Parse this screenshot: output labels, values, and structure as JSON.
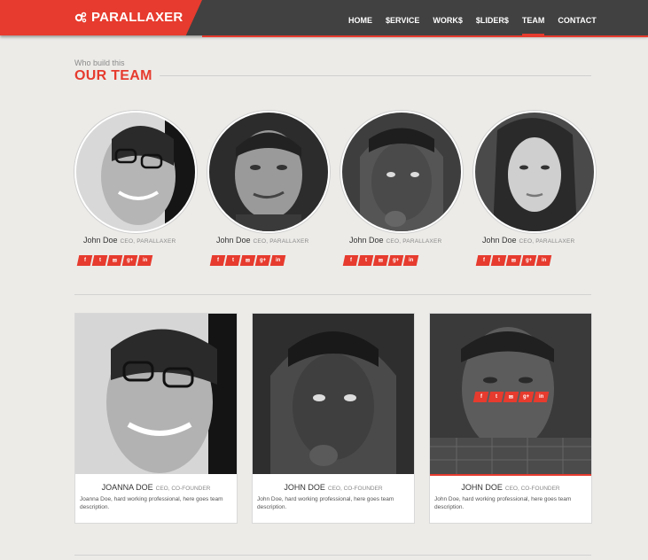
{
  "brand": {
    "name": "PARALLAXER",
    "accent": "#e63b2e",
    "header_bg": "#414141"
  },
  "nav": {
    "items": [
      {
        "label": "HOME"
      },
      {
        "label": "$ERVICE"
      },
      {
        "label": "WORK$"
      },
      {
        "label": "$LIDER$"
      },
      {
        "label": "TEAM",
        "active": true
      },
      {
        "label": "CONTACT"
      }
    ]
  },
  "section": {
    "subtitle": "Who build this",
    "title": "OUR TEAM"
  },
  "members": [
    {
      "name": "John Doe",
      "role": "CEO, PARALLAXER"
    },
    {
      "name": "John Doe",
      "role": "CEO, PARALLAXER"
    },
    {
      "name": "John Doe",
      "role": "CEO, PARALLAXER"
    },
    {
      "name": "John Doe",
      "role": "CEO, PARALLAXER"
    }
  ],
  "social_icons": [
    "facebook-icon",
    "twitter-icon",
    "email-icon",
    "google-plus-icon",
    "linkedin-icon"
  ],
  "social_glyphs": [
    "f",
    "t",
    "✉",
    "g+",
    "in"
  ],
  "cards": [
    {
      "name": "JOANNA DOE",
      "role": "CEO, CO-FOUNDER",
      "desc": "Joanna Doe, hard working professional, here goes team description."
    },
    {
      "name": "JOHN DOE",
      "role": "CEO, CO-FOUNDER",
      "desc": "John Doe, hard working professional, here goes team description."
    },
    {
      "name": "JOHN DOE",
      "role": "CEO, CO-FOUNDER",
      "desc": "John Doe, hard working professional, here goes team description."
    }
  ]
}
